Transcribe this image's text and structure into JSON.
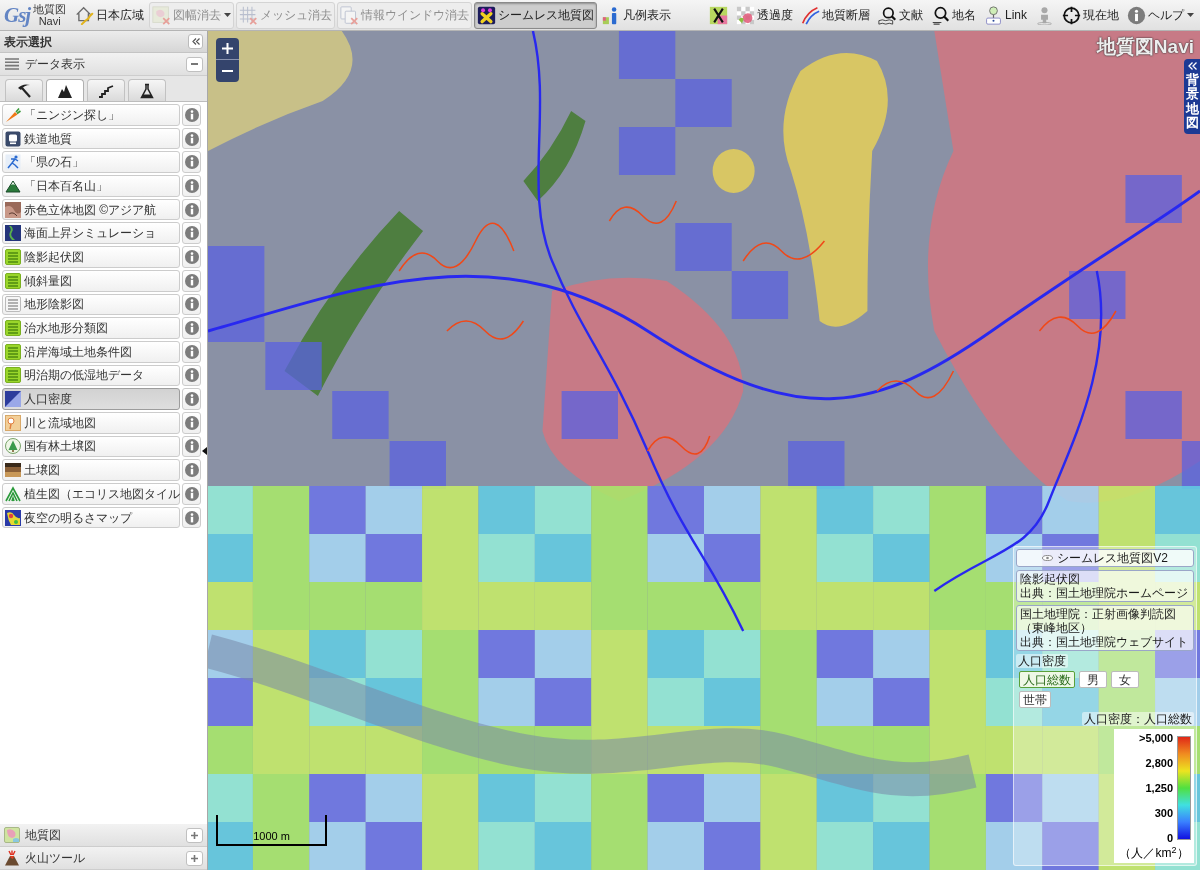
{
  "toolbar": {
    "logo": {
      "mark": "Gsj",
      "title": "地質図",
      "subtitle": "Navi"
    },
    "buttons": [
      {
        "label": "日本広域",
        "selected": false,
        "disabled": false,
        "menu": false
      },
      {
        "label": "図幅消去",
        "selected": false,
        "disabled": true,
        "menu": true
      },
      {
        "label": "メッシュ消去",
        "selected": false,
        "disabled": true,
        "menu": false
      },
      {
        "label": "情報ウインドウ消去",
        "selected": false,
        "disabled": true,
        "menu": false
      },
      {
        "label": "シームレス地質図",
        "selected": true,
        "disabled": false,
        "menu": false
      },
      {
        "label": "凡例表示",
        "selected": false,
        "disabled": false,
        "menu": false
      },
      {
        "selected": false,
        "disabled": false,
        "menu": false
      },
      {
        "label": "透過度",
        "selected": false,
        "disabled": false,
        "menu": false
      },
      {
        "label": "地質断層",
        "selected": false,
        "disabled": false,
        "menu": false
      },
      {
        "label": "文献",
        "selected": false,
        "disabled": false,
        "menu": false
      },
      {
        "label": "地名",
        "selected": false,
        "disabled": false,
        "menu": false
      },
      {
        "label": "Link",
        "selected": false,
        "disabled": false,
        "menu": false
      },
      {
        "selected": false,
        "disabled": false,
        "menu": false
      },
      {
        "label": "現在地",
        "selected": false,
        "disabled": false,
        "menu": false
      },
      {
        "label": "ヘルプ",
        "selected": false,
        "disabled": false,
        "menu": true
      }
    ]
  },
  "sidebar": {
    "title": "表示選択",
    "panels": [
      {
        "title": "データ表示",
        "expanded": true,
        "tabs": [
          {
            "selected": false
          },
          {
            "selected": true
          },
          {
            "selected": false
          },
          {
            "selected": false
          }
        ],
        "items": [
          {
            "label": "「ニンジン探し」",
            "selected": false
          },
          {
            "label": "鉄道地質",
            "selected": false
          },
          {
            "label": "「県の石」",
            "selected": false
          },
          {
            "label": "「日本百名山」",
            "selected": false
          },
          {
            "label": "赤色立体地図 ©アジア航",
            "selected": false
          },
          {
            "label": "海面上昇シミュレーショ",
            "selected": false
          },
          {
            "label": "陰影起伏図",
            "selected": false
          },
          {
            "label": "傾斜量図",
            "selected": false
          },
          {
            "label": "地形陰影図",
            "selected": false
          },
          {
            "label": "治水地形分類図",
            "selected": false
          },
          {
            "label": "沿岸海域土地条件図",
            "selected": false
          },
          {
            "label": "明治期の低湿地データ",
            "selected": false
          },
          {
            "label": "人口密度",
            "selected": true
          },
          {
            "label": "川と流域地図",
            "selected": false
          },
          {
            "label": "国有林土壌図",
            "selected": false
          },
          {
            "label": "土壌図",
            "selected": false
          },
          {
            "label": "植生図（エコリス地図タイル",
            "selected": false
          },
          {
            "label": "夜空の明るさマップ",
            "selected": false
          }
        ]
      },
      {
        "title": "地質図",
        "expanded": false
      },
      {
        "title": "火山ツール",
        "expanded": false
      }
    ]
  },
  "map": {
    "logo": "地質図Navi",
    "background_tab": "背景地図",
    "scale": "1000 m",
    "legend": {
      "header": "シームレス地質図V2",
      "sources": [
        {
          "title": "陰影起伏図",
          "credit": "出典：国土地理院ホームページ"
        },
        {
          "title": "国土地理院：正射画像判読図",
          "note": "（東峰地区）",
          "credit": "出典：国土地理院ウェブサイト"
        }
      ],
      "population": {
        "title": "人口密度",
        "buttons": [
          {
            "label": "人口総数",
            "selected": true
          },
          {
            "label": "男",
            "selected": false
          },
          {
            "label": "女",
            "selected": false
          },
          {
            "label": "世帯",
            "selected": false
          }
        ],
        "scale_title": "人口密度：人口総数",
        "ticks": [
          ">5,000",
          "2,800",
          "1,250",
          "300",
          "0"
        ],
        "unit": "（人／km$^{2}$）"
      }
    }
  }
}
